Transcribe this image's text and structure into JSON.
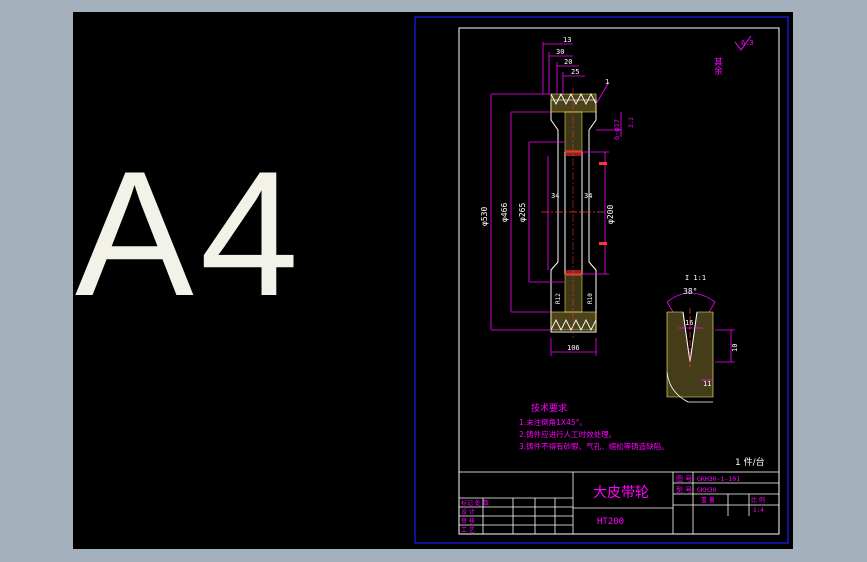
{
  "sheet": {
    "size_label": "A4",
    "colors": {
      "background": "#000000",
      "frame": "#1a1aff",
      "inner_frame": "#ffffff",
      "dimension": "#ff00ff",
      "hatch": "#ffff66",
      "center_line": "#ff3333",
      "outline": "#ffffff",
      "app_background": "#a4b0bc"
    }
  },
  "drawing": {
    "roughness_symbol": "6.3",
    "roughness_note": "其余",
    "dims": {
      "d13": "13",
      "d30": "30",
      "d20": "20",
      "d25": "25",
      "chamfer": "1",
      "holes": "6-φ17",
      "dia530": "φ530",
      "dia466": "φ466",
      "dia265": "φ265",
      "dia200": "φ200",
      "d34a": "34",
      "d34b": "34",
      "width106": "106",
      "r12": "R12",
      "r10": "R10",
      "groove_roughness": "3.2"
    },
    "groove_detail": {
      "angle": "38°",
      "d16": "16",
      "d10": "10",
      "d11": "11",
      "scale": "I 1:1"
    }
  },
  "tech_req": {
    "title": "技术要求",
    "items": [
      "1.未注倒角1X45°。",
      "2.铸件应进行人工时效处理。",
      "3.铸件不得有砂眼、气孔、缩松等铸造缺陷。"
    ]
  },
  "title_block": {
    "qty_note": "1 件/台",
    "part_name": "大皮带轮",
    "material": "HT200",
    "drawing_no_label": "图 号",
    "drawing_no": "GKH30-1-101",
    "code_label": "型 号",
    "code": "GKH30",
    "weight_label": "重 量",
    "scale_label": "比 例",
    "scale": "1:4",
    "rows": [
      "标记 处 数",
      "设 计",
      "审 核",
      "工 艺"
    ]
  }
}
